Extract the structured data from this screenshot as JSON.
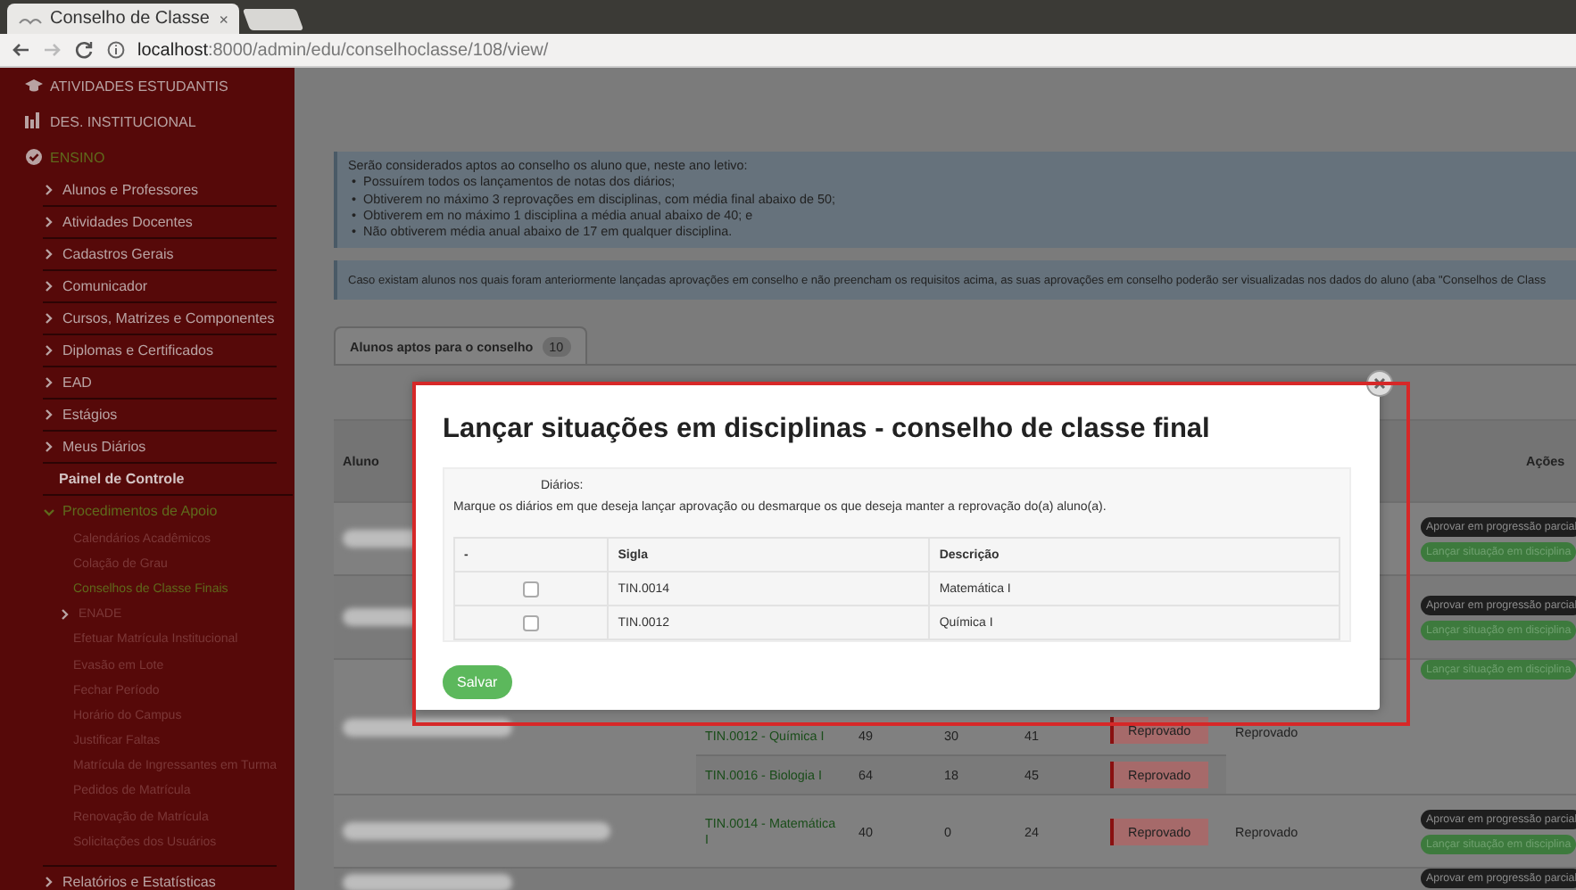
{
  "browser": {
    "tab_title": "Conselho de Classe",
    "tab_close": "×",
    "url_host": "localhost",
    "url_rest": ":8000/admin/edu/conselhoclasse/108/view/"
  },
  "sidebar": {
    "items": [
      {
        "label": "ATIVIDADES ESTUDANTIS",
        "kind": "section",
        "expanded": false
      },
      {
        "label": "DES. INSTITUCIONAL",
        "kind": "section",
        "expanded": false
      },
      {
        "label": "ENSINO",
        "kind": "section",
        "expanded": true,
        "children": [
          {
            "label": "Alunos e Professores",
            "kind": "group",
            "expanded": false
          },
          {
            "label": "Atividades Docentes",
            "kind": "group",
            "expanded": false
          },
          {
            "label": "Cadastros Gerais",
            "kind": "group",
            "expanded": false
          },
          {
            "label": "Comunicador",
            "kind": "group",
            "expanded": false
          },
          {
            "label": "Cursos, Matrizes e Componentes",
            "kind": "group",
            "expanded": false
          },
          {
            "label": "Diplomas e Certificados",
            "kind": "group",
            "expanded": false
          },
          {
            "label": "EAD",
            "kind": "group",
            "expanded": false
          },
          {
            "label": "Estágios",
            "kind": "group",
            "expanded": false
          },
          {
            "label": "Meus Diários",
            "kind": "group",
            "expanded": false
          },
          {
            "label": "Painel de Controle",
            "kind": "link"
          },
          {
            "label": "Procedimentos de Apoio",
            "kind": "group",
            "expanded": true,
            "children": [
              {
                "label": "Calendários Acadêmicos",
                "kind": "link",
                "selected": false
              },
              {
                "label": "Colação de Grau",
                "kind": "link",
                "selected": false
              },
              {
                "label": "Conselhos de Classe Finais",
                "kind": "link",
                "selected": true
              },
              {
                "label": "ENADE",
                "kind": "group",
                "selected": false,
                "expanded": false
              },
              {
                "label": "Efetuar Matrícula Institucional",
                "kind": "link",
                "selected": false
              },
              {
                "label": "Evasão em Lote",
                "kind": "link",
                "selected": false
              },
              {
                "label": "Fechar Período",
                "kind": "link",
                "selected": false
              },
              {
                "label": "Horário do Campus",
                "kind": "link",
                "selected": false
              },
              {
                "label": "Justificar Faltas",
                "kind": "link",
                "selected": false
              },
              {
                "label": "Matrícula de Ingressantes em Turma",
                "kind": "link",
                "selected": false
              },
              {
                "label": "Pedidos de Matrícula",
                "kind": "link",
                "selected": false
              },
              {
                "label": "Renovação de Matrícula",
                "kind": "link",
                "selected": false
              },
              {
                "label": "Solicitações dos Usuários",
                "kind": "link",
                "selected": false
              }
            ]
          },
          {
            "label": "Relatórios e Estatísticas",
            "kind": "group",
            "expanded": false
          }
        ]
      }
    ]
  },
  "info": {
    "bullet": "•",
    "intro": "Serão considerados aptos ao conselho os aluno que, neste ano letivo:",
    "rules": [
      "Possuírem todos os lançamentos de notas dos diários;",
      "Obtiverem no máximo 3 reprovações em disciplinas, com média final abaixo de 50;",
      "Obtiverem em no máximo 1 disciplina a média anual abaixo de 40; e",
      "Não obtiverem média anual abaixo de 17 em qualquer disciplina."
    ]
  },
  "notice": "Caso existam alunos nos quais foram anteriormente lançadas aprovações em conselho e não preencham os requisitos acima, as suas aprovações em conselho poderão ser visualizadas nos dados do aluno (aba \"Conselhos de Class",
  "tabs": [
    {
      "label": "Alunos aptos para o conselho",
      "count": "10",
      "selected": true
    }
  ],
  "table": {
    "columns": [
      "Aluno",
      "Ações"
    ],
    "rows": [
      {
        "disciplines": [],
        "actions": [
          {
            "label": "Aprovar em progressão parcial",
            "kind": "dark"
          },
          {
            "label": "Lançar situação em disciplina",
            "kind": "green"
          }
        ]
      },
      {
        "disciplines": [],
        "actions": [
          {
            "label": "Aprovar em progressão parcial",
            "kind": "dark"
          },
          {
            "label": "Lançar situação em disciplina",
            "kind": "green"
          }
        ]
      },
      {
        "disciplines": [
          {
            "name": "TIN.0012 - Química I",
            "n1": "49",
            "n2": "30",
            "n3": "41",
            "status": "Reprovado"
          },
          {
            "name": "TIN.0016 - Biologia I",
            "n1": "64",
            "n2": "18",
            "n3": "45",
            "status": "Reprovado"
          }
        ],
        "final": "Reprovado",
        "actions": [
          {
            "label": "Lançar situação em disciplina",
            "kind": "green"
          }
        ]
      },
      {
        "disciplines": [
          {
            "name": "TIN.0014 - Matemática I",
            "n1": "40",
            "n2": "0",
            "n3": "24",
            "status": "Reprovado"
          }
        ],
        "final": "Reprovado",
        "actions": [
          {
            "label": "Aprovar em progressão parcial",
            "kind": "dark"
          },
          {
            "label": "Lançar situação em disciplina",
            "kind": "green"
          }
        ]
      },
      {
        "disciplines": [],
        "actions": [
          {
            "label": "Aprovar em progressão parcial",
            "kind": "dark"
          }
        ]
      }
    ]
  },
  "modal": {
    "title": "Lançar situações em disciplinas - conselho de classe final",
    "field_label": "Diários:",
    "help": "Marque os diários em que deseja lançar aprovação ou desmarque os que deseja manter a reprovação do(a) aluno(a).",
    "columns": [
      "-",
      "Sigla",
      "Descrição"
    ],
    "rows": [
      {
        "checked": false,
        "code": "TIN.0014",
        "description": "Matemática I"
      },
      {
        "checked": false,
        "code": "TIN.0012",
        "description": "Química I"
      }
    ],
    "save": "Salvar"
  }
}
